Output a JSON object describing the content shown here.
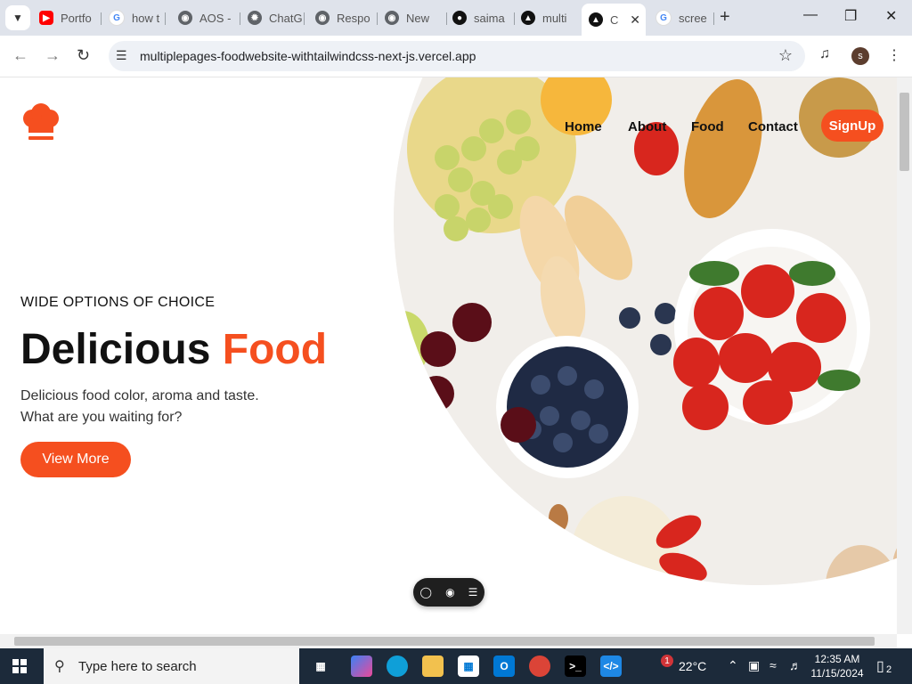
{
  "browser": {
    "tabs": [
      {
        "label": "Portfo",
        "icon": "youtube-icon",
        "color": "#ff0000"
      },
      {
        "label": "how t",
        "icon": "google-icon",
        "color": "#4285f4"
      },
      {
        "label": "AOS -",
        "icon": "globe-icon",
        "color": "#5f6368"
      },
      {
        "label": "ChatG",
        "icon": "chatgpt-icon",
        "color": "#5f6368"
      },
      {
        "label": "Respo",
        "icon": "globe-icon",
        "color": "#5f6368"
      },
      {
        "label": "New",
        "icon": "chrome-icon",
        "color": "#5f6368"
      },
      {
        "label": "saima",
        "icon": "github-icon",
        "color": "#111111"
      },
      {
        "label": "multi",
        "icon": "vercel-icon",
        "color": "#111111"
      },
      {
        "label": "C",
        "icon": "vercel-icon",
        "color": "#111111",
        "active": true
      },
      {
        "label": "scree",
        "icon": "google-icon",
        "color": "#4285f4"
      }
    ],
    "url": "multiplepages-foodwebsite-withtailwindcss-next-js.vercel.app",
    "profile_initial": "s"
  },
  "site": {
    "nav": {
      "home": "Home",
      "about": "About",
      "food": "Food",
      "contact": "Contact",
      "signup": "SignUp"
    },
    "hero": {
      "kicker": "WIDE OPTIONS OF CHOICE",
      "headline_word1": "Delicious",
      "headline_word2": "Food",
      "desc_line1": "Delicious food color, aroma and taste.",
      "desc_line2": "What are you waiting for?",
      "cta": "View More"
    },
    "accent_color": "#f54f1f"
  },
  "taskbar": {
    "search_placeholder": "Type here to search",
    "weather": "22°C",
    "time": "12:35 AM",
    "date": "11/15/2024",
    "notification_count": "2",
    "edge_badge": "1"
  }
}
